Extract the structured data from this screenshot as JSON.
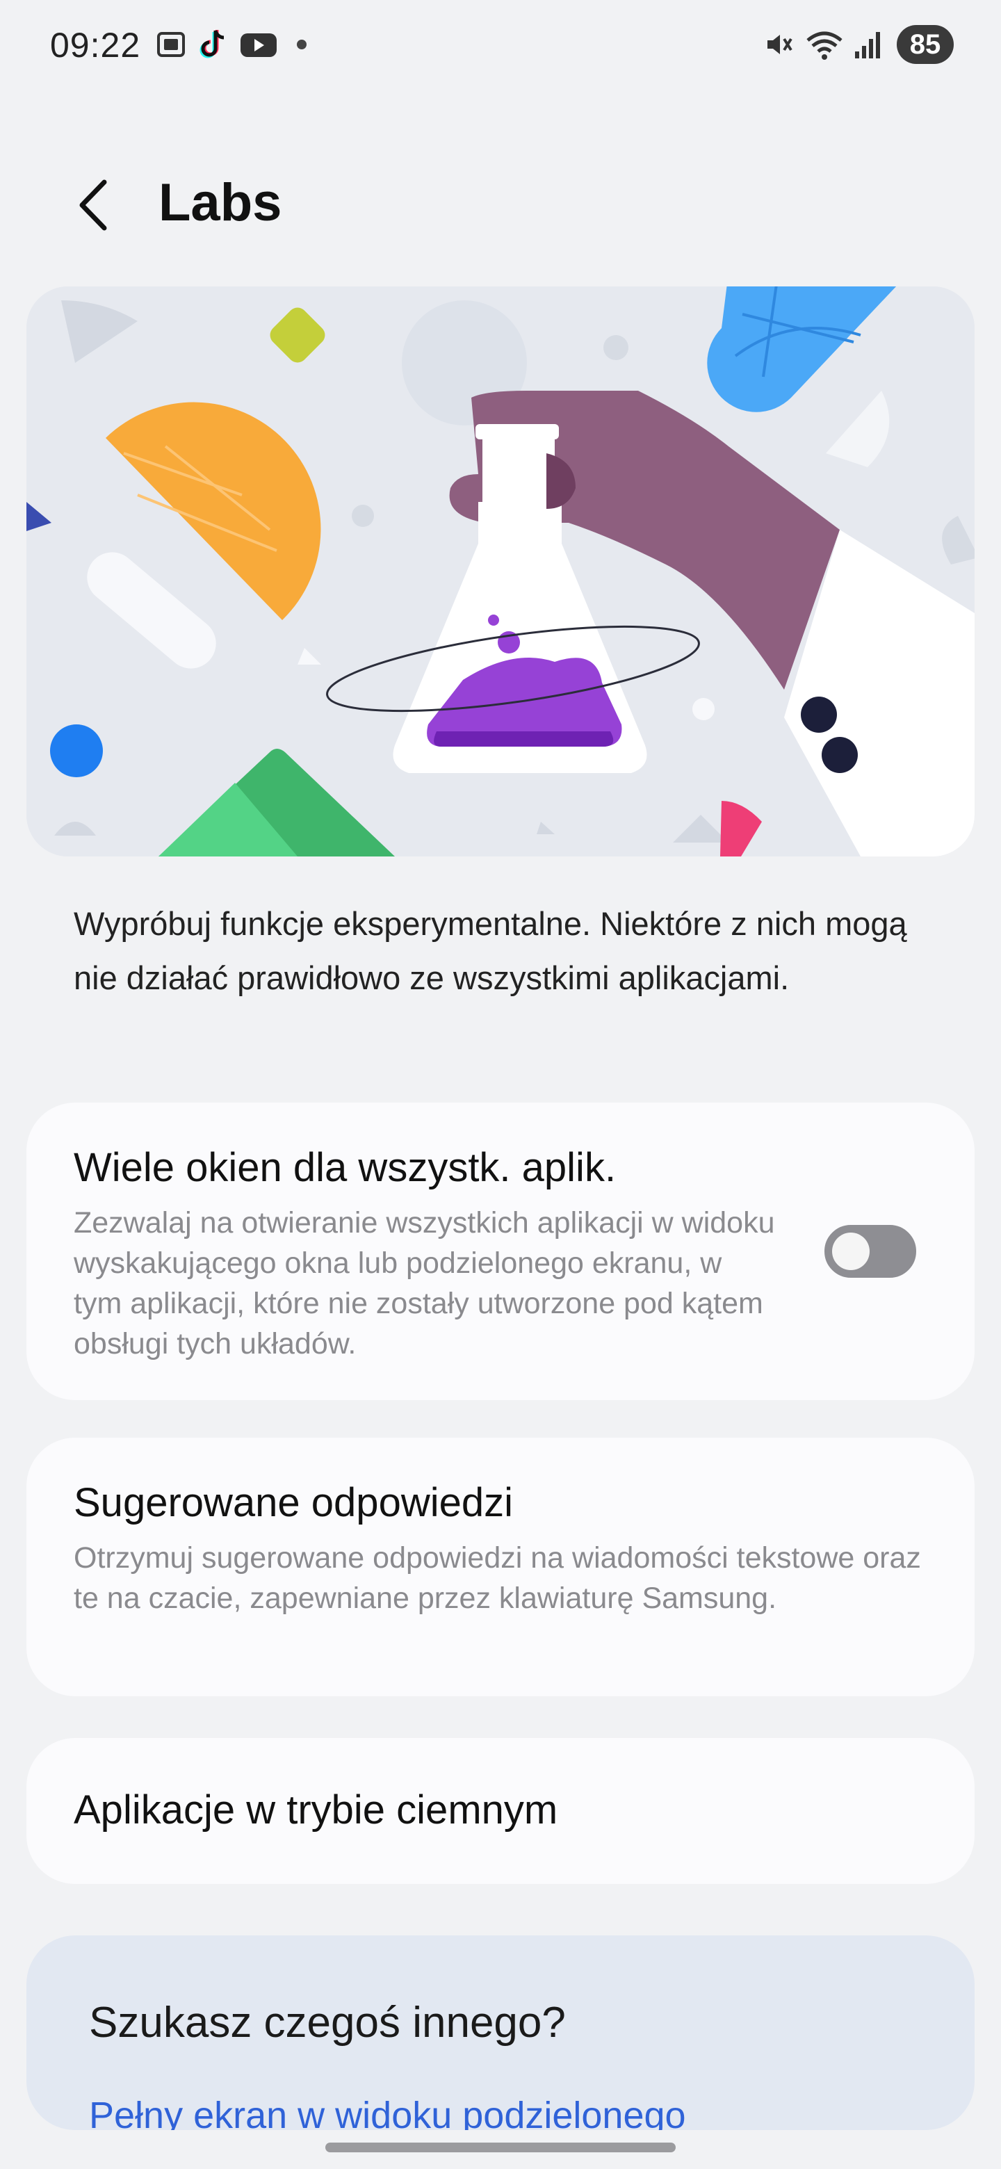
{
  "status_bar": {
    "time": "09:22",
    "battery": "85",
    "left_icons": [
      "screenshot-icon",
      "tiktok-icon",
      "youtube-icon",
      "dot-icon"
    ],
    "right_icons": [
      "mute-icon",
      "wifi-icon",
      "signal-icon"
    ]
  },
  "header": {
    "title": "Labs"
  },
  "description": "Wypróbuj funkcje eksperymentalne. Niektóre z nich mogą nie działać prawidłowo ze wszystkimi aplikacjami.",
  "settings": [
    {
      "title": "Wiele okien dla wszystk. aplik.",
      "subtitle": "Zezwalaj na otwieranie wszystkich aplikacji w widoku wyskakującego okna lub podzielonego ekranu, w tym aplikacji, które nie zostały utworzone pod kątem obsługi tych układów.",
      "toggle_on": false
    },
    {
      "title": "Sugerowane odpowiedzi",
      "subtitle": "Otrzymuj sugerowane odpowiedzi na wiadomości tekstowe oraz te na czacie, zapewniane przez klawiaturę Samsung."
    },
    {
      "title": "Aplikacje w trybie ciemnym"
    }
  ],
  "looking_for": {
    "title": "Szukasz czegoś innego?",
    "link": "Pełny ekran w widoku podzielonego"
  },
  "colors": {
    "background": "#f1f2f4",
    "card": "#fbfbfd",
    "link": "#2f62d8",
    "hero_background": "#e6e9ef"
  }
}
